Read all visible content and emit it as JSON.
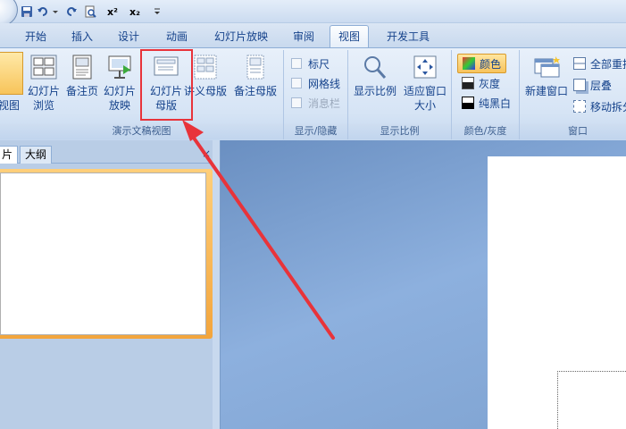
{
  "tabs": [
    "开始",
    "插入",
    "设计",
    "动画",
    "幻灯片放映",
    "审阅",
    "视图",
    "开发工具"
  ],
  "active_tab": "视图",
  "ribbon": {
    "groups": {
      "presentation_views": {
        "label": "演示文稿视图",
        "buttons": {
          "normal": "视图",
          "sorter": "幻灯片浏览",
          "notes": "备注页",
          "slideshow": "幻灯片放映",
          "slide_master": "幻灯片母版",
          "handout_master": "讲义母版",
          "notes_master": "备注母版"
        }
      },
      "show_hide": {
        "label": "显示/隐藏",
        "ruler": "标尺",
        "gridlines": "网格线",
        "message_bar": "消息栏"
      },
      "zoom": {
        "label": "显示比例",
        "zoom_btn": "显示比例",
        "fit_btn": "适应窗口大小"
      },
      "color": {
        "label": "颜色/灰度",
        "color": "颜色",
        "grayscale": "灰度",
        "bw": "纯黑白"
      },
      "window": {
        "label": "窗口",
        "new_window": "新建窗口",
        "arrange_all": "全部重排",
        "cascade": "层叠",
        "move_split": "移动拆分"
      }
    }
  },
  "left_panel": {
    "tab_slides": "片",
    "tab_outline": "大纲"
  },
  "colors": {
    "highlight": "#e8333a",
    "active_tab": "#f3a53c"
  }
}
